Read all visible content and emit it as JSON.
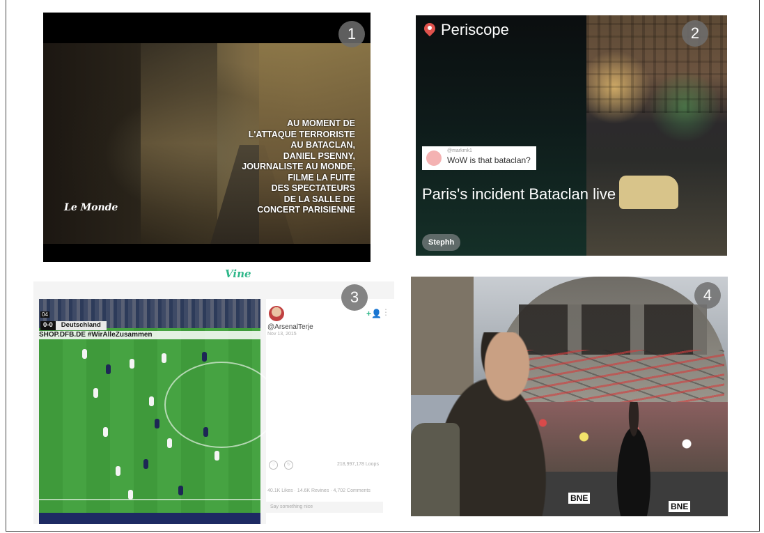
{
  "panels": {
    "p1": {
      "number": "1",
      "overlay_lines": [
        "AU MOMENT DE",
        "L'ATTAQUE TERRORISTE",
        "AU BATACLAN,",
        "DANIEL PSENNY,",
        "JOURNALISTE AU MONDE,",
        "FILME LA FUITE",
        "DES SPECTATEURS",
        "DE LA SALLE DE",
        "CONCERT PARISIENNE"
      ],
      "logo": "Le Monde"
    },
    "p2": {
      "number": "2",
      "app_name": "Periscope",
      "comment_user": "@markmk1",
      "comment_text": "WoW is that bataclan?",
      "title": "Paris's incident Bataclan live",
      "broadcaster": "Stephh"
    },
    "vine_logo": "Vine",
    "p3": {
      "number": "3",
      "score": "0-0",
      "team": "Deutschland",
      "ad_text": "SHOP.DFB.DE  #WirAlleZusammen",
      "clock_badge": "04",
      "handle": "@ArsenalTerje",
      "date": "Nov 13, 2015",
      "loops": "218,997,178 Loops",
      "stats": "40.1K Likes · 14.6K Revines · 4,702 Comments",
      "comment_placeholder": "Say something nice"
    },
    "p4": {
      "number": "4",
      "sign1": "BNE",
      "sign2": "BNE"
    }
  },
  "colors": {
    "periscope_red": "#e0524c",
    "vine_green": "#2fb78a",
    "badge_gray": "#6e6e6e"
  }
}
